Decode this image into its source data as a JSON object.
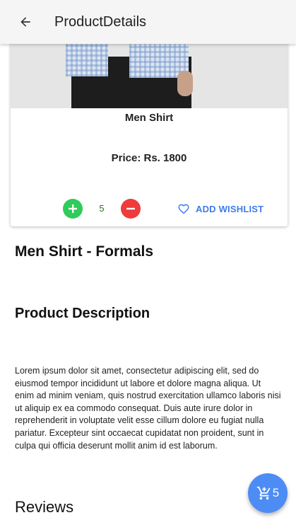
{
  "appbar": {
    "title": "ProductDetails",
    "back_icon": "arrow-left-icon"
  },
  "product": {
    "name": "Men Shirt",
    "price": "Price: Rs. 1800",
    "quantity": "5",
    "wishlist_label": "ADD WISHLIST",
    "full_title": "Men Shirt - Formals"
  },
  "description": {
    "heading": "Product Description",
    "text": "Lorem ipsum dolor sit amet, consectetur adipiscing elit, sed do eiusmod tempor incididunt ut labore et dolore magna aliqua. Ut enim ad minim veniam, quis nostrud exercitation ullamco laboris nisi ut aliquip ex ea commodo consequat. Duis aute irure dolor in reprehenderit in voluptate velit esse cillum dolore eu fugiat nulla pariatur. Excepteur sint occaecat cupidatat non proident, sunt in culpa qui officia deserunt mollit anim id est laborum."
  },
  "reviews": {
    "heading": "Reviews"
  },
  "cart": {
    "count": "5",
    "icon": "cart-icon"
  },
  "colors": {
    "accent": "#3d7de8",
    "plus": "#2ecc5a",
    "minus": "#ee3b3b",
    "fab": "#4d8cf5"
  }
}
